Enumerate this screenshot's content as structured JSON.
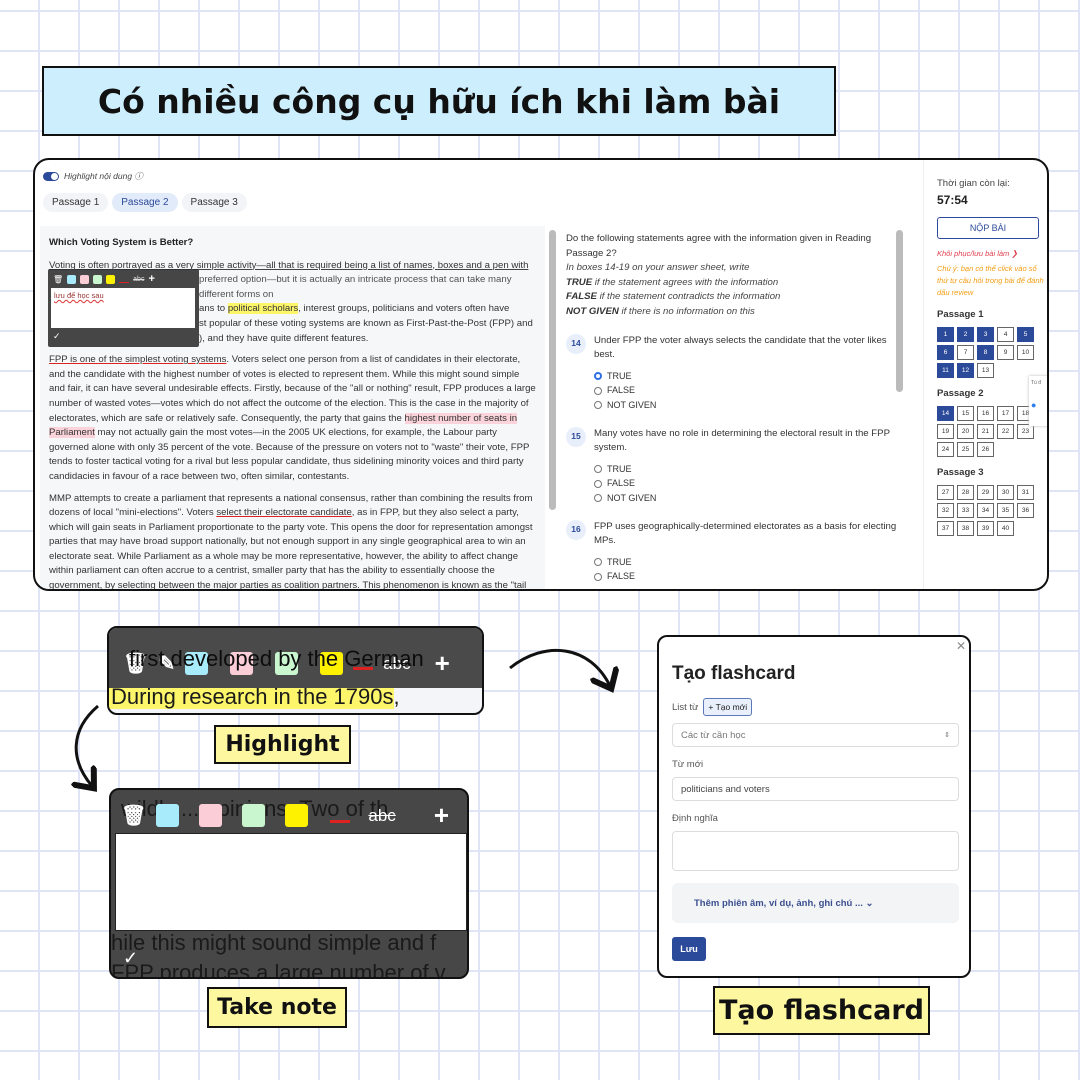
{
  "headline": "Có nhiều công cụ hữu ích khi làm bài",
  "app": {
    "highlight_toggle": "Highlight nội dung ⓘ",
    "tabs": [
      "Passage 1",
      "Passage 2",
      "Passage 3"
    ],
    "passage": {
      "title": "Which Voting System is Better?",
      "p1_l1": "Voting is often portrayed as a very simple activity—all that is required being a list of names, boxes and a pen with",
      "p1_l2": "preferred option—but it is actually an intricate process that can take many different forms on",
      "p1_l3a": "ans to ",
      "p1_l3h": "political scholars",
      "p1_l3b": ", interest groups, politicians and voters often have",
      "p1_l4": "st popular of these voting systems are known as First-Past-the-Post (FPP) and",
      "p1_l5": "), and they have quite different features.",
      "p2_u": "FPP is one of the simplest voting systems",
      "p2_a": ". Voters select one person from a list of candidates in their electorate, and the candidate with the highest number of votes is elected to represent them. While this might sound simple and fair, it can have several undesirable effects. Firstly, because of the \"all or nothing\" result, FPP produces a large number of wasted votes—votes which do not affect the outcome of the election. This is the case in the majority of electorates, which are safe or relatively safe. Consequently, the party that gains the ",
      "p2_h": "highest number of seats in Parliament",
      "p2_b": " may not actually gain the most votes—in the 2005 UK elections, for example, the Labour party governed alone with only 35 percent of the vote. Because of the pressure on voters not to \"waste\" their vote, FPP tends to foster tactical voting for a rival but less popular candidate, thus sidelining minority voices and third party candidacies in favour of a race between two, often similar, contestants.",
      "p3_a": "MMP attempts to create a parliament that represents a national consensus, rather than combining the results from dozens of local \"mini-elections\". Voters ",
      "p3_u": "select their electorate candidate",
      "p3_b": ", as in FPP, but they also select a party, which will gain seats in Parliament proportionate to the party vote. This opens the door for representation amongst parties that may have broad support nationally, but not enough support in any single geographical area to win an electorate seat. While Parliament as a whole may be more representative, however, the ability to affect change within parliament can often accrue to a centrist, smaller party that has the ability to essentially choose the government, by selecting between the major parties as coalition partners. This phenomenon is known as the \"tail"
    },
    "note_popup": {
      "text": "lưu để học sau",
      "abc": "abc",
      "colors": [
        "#a8ecfb",
        "#fbcdd6",
        "#c9f5cf",
        "#fff200"
      ]
    },
    "instructions": {
      "l1": "Do the following statements agree with the information given in Reading Passage 2?",
      "l2": "In boxes 14-19 on your answer sheet, write",
      "t_b": "TRUE",
      "t_r": " if the statement agrees with the information",
      "f_b": "FALSE",
      "f_r": " if the statement contradicts the information",
      "n_b": "NOT GIVEN",
      "n_r": " if there is no information on this"
    },
    "questions": [
      {
        "num": "14",
        "text": "Under FPP the voter always selects the candidate that the voter likes best.",
        "options": [
          "TRUE",
          "FALSE",
          "NOT GIVEN"
        ],
        "selected": "TRUE"
      },
      {
        "num": "15",
        "text": "Many votes have no role in determining the electoral result in the FPP system.",
        "options": [
          "TRUE",
          "FALSE",
          "NOT GIVEN"
        ],
        "selected": null
      },
      {
        "num": "16",
        "text": "FPP uses geographically-determined electorates as a basis for electing MPs.",
        "options": [
          "TRUE",
          "FALSE"
        ],
        "selected": null
      }
    ],
    "sidebar": {
      "time_label": "Thời gian còn lại:",
      "time": "57:54",
      "submit": "NỘP BÀI",
      "restore": "Khôi phục/lưu bài làm ❯",
      "tip": "Chú ý: bạn có thể click vào số thứ tự câu hỏi trong bài để đánh dấu review",
      "passages": [
        {
          "name": "Passage 1",
          "nums": [
            "1",
            "2",
            "3",
            "4",
            "5",
            "6",
            "7",
            "8",
            "9",
            "10",
            "11",
            "12",
            "13"
          ],
          "done": [
            "1",
            "2",
            "3",
            "5",
            "6",
            "8",
            "11",
            "12"
          ]
        },
        {
          "name": "Passage 2",
          "nums": [
            "14",
            "15",
            "16",
            "17",
            "18",
            "19",
            "20",
            "21",
            "22",
            "23",
            "24",
            "25",
            "26"
          ],
          "done": [
            "14"
          ]
        },
        {
          "name": "Passage 3",
          "nums": [
            "27",
            "28",
            "29",
            "30",
            "31",
            "32",
            "33",
            "34",
            "35",
            "36",
            "37",
            "38",
            "39",
            "40"
          ],
          "done": []
        }
      ],
      "float_text": "Tú đ"
    }
  },
  "highlight_demo": {
    "behind": "first developed by the German",
    "text": "During research in the 1790s",
    "after": ",",
    "abc": "abc",
    "label": "Highlight"
  },
  "note_demo": {
    "behind1": "wildly ... opinions. Two of th",
    "behind2": "hile this might sound simple and f",
    "behind3": "FPP produces a large number of v",
    "abc": "abc",
    "label": "Take note"
  },
  "flashcard": {
    "title": "Tạo flashcard",
    "list_label": "List từ",
    "create_new": "+ Tạo mới",
    "list_value": "Các từ cần học",
    "word_label": "Từ mới",
    "word_value": "politicians and voters",
    "def_label": "Định nghĩa",
    "def_value": "",
    "more": "Thêm phiên âm, ví dụ, ảnh, ghi chú ... ⌄",
    "save": "Lưu",
    "label": "Tạo flashcard"
  }
}
